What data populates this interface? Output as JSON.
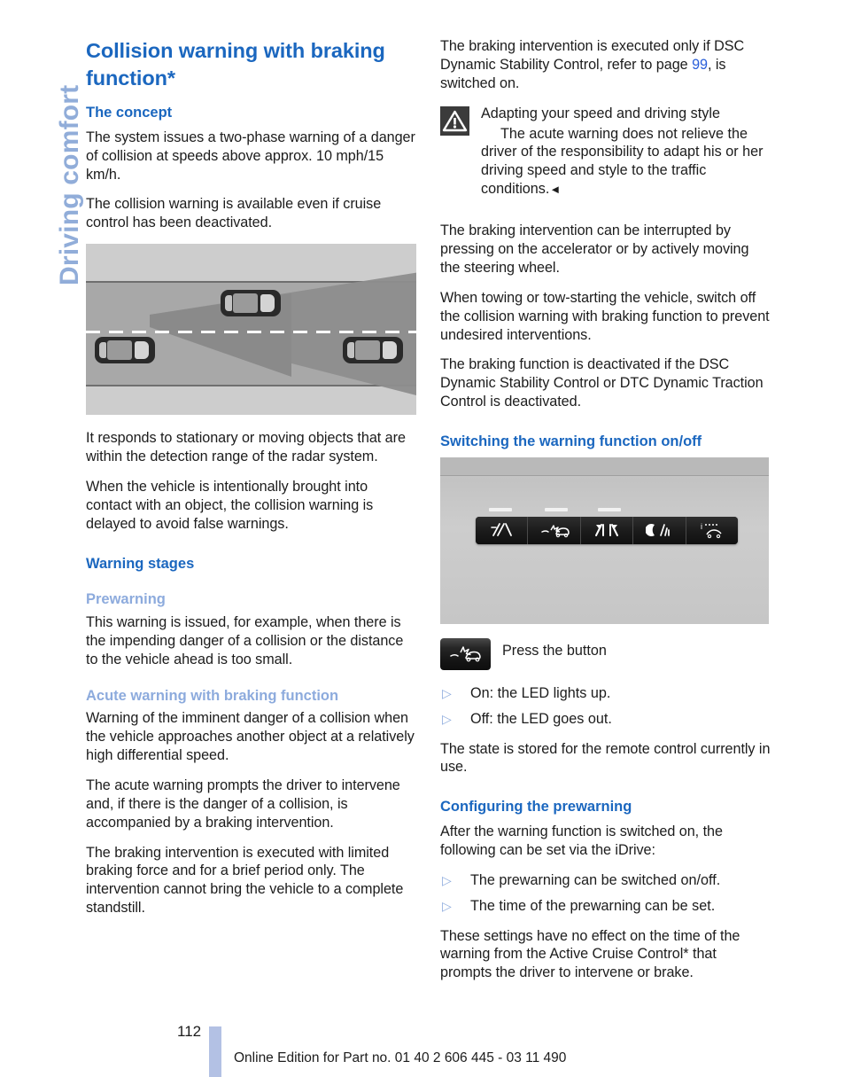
{
  "sidebar": {
    "chapter_label": "Driving comfort"
  },
  "colors": {
    "heading_blue": "#1b67bf",
    "subheading_blue": "#8dabdd",
    "link_blue": "#2a5fda",
    "side_tab_blue": "#91add9",
    "footer_bar_blue": "#b3c1e4"
  },
  "left_column": {
    "title": "Collision warning with braking function*",
    "concept_heading": "The concept",
    "concept_p1": "The system issues a two-phase warning of a danger of collision at speeds above approx. 10 mph/15 km/h.",
    "concept_p2": "The collision warning is available even if cruise control has been deactivated.",
    "figure_road_name": "road-radar-detection-illustration",
    "after_figure_p1": "It responds to stationary or moving objects that are within the detection range of the radar system.",
    "after_figure_p2": "When the vehicle is intentionally brought into contact with an object, the collision warning is delayed to avoid false warnings.",
    "warning_stages_heading": "Warning stages",
    "prewarning_heading": "Prewarning",
    "prewarning_p1": "This warning is issued, for example, when there is the impending danger of a collision or the distance to the vehicle ahead is too small.",
    "acute_heading": "Acute warning with braking function",
    "acute_p1": "Warning of the imminent danger of a collision when the vehicle approaches another object at a relatively high differential speed.",
    "acute_p2": "The acute warning prompts the driver to intervene and, if there is the danger of a collision, is accompanied by a braking intervention.",
    "acute_p3": "The braking intervention is executed with limited braking force and for a brief period only. The intervention cannot bring the vehicle to a complete standstill."
  },
  "right_column": {
    "dsc_p1_before": "The braking intervention is executed only if DSC Dynamic Stability Control, refer to page ",
    "dsc_page_link": "99",
    "dsc_p1_after": ", is switched on.",
    "note": {
      "icon": "warning-triangle-icon",
      "title": "Adapting your speed and driving style",
      "body": "The acute warning does not relieve the driver of the responsibility to adapt his or her driving speed and style to the traffic conditions.",
      "end_marker": "◄"
    },
    "p_interrupt": "The braking intervention can be interrupted by pressing on the accelerator or by actively moving the steering wheel.",
    "p_towing": "When towing or tow-starting the vehicle, switch off the collision warning with braking function to prevent undesired interventions.",
    "p_deactivated": "The braking function is deactivated if the DSC Dynamic Stability Control or DTC Dynamic Traction Control is deactivated.",
    "switching_heading": "Switching the warning function on/off",
    "figure_panel_name": "dashboard-button-panel-photo",
    "press_button_caption": "Press the button",
    "press_button_icon": "collision-warning-button-icon",
    "led_bullets": [
      {
        "marker": "▷",
        "text": "On: the LED lights up."
      },
      {
        "marker": "▷",
        "text": "Off: the LED goes out."
      }
    ],
    "p_state_stored": "The state is stored for the remote control currently in use.",
    "configuring_heading": "Configuring the prewarning",
    "p_after_switched_on": "After the warning function is switched on, the following can be set via the iDrive:",
    "config_bullets": [
      {
        "marker": "▷",
        "text": "The prewarning can be switched on/off."
      },
      {
        "marker": "▷",
        "text": "The time of the prewarning can be set."
      }
    ],
    "p_no_effect": "These settings have no effect on the time of the warning from the Active Cruise Control* that prompts the driver to intervene or brake."
  },
  "footer": {
    "page_number": "112",
    "text": "Online Edition for Part no. 01 40 2 606 445 - 03 11 490"
  }
}
